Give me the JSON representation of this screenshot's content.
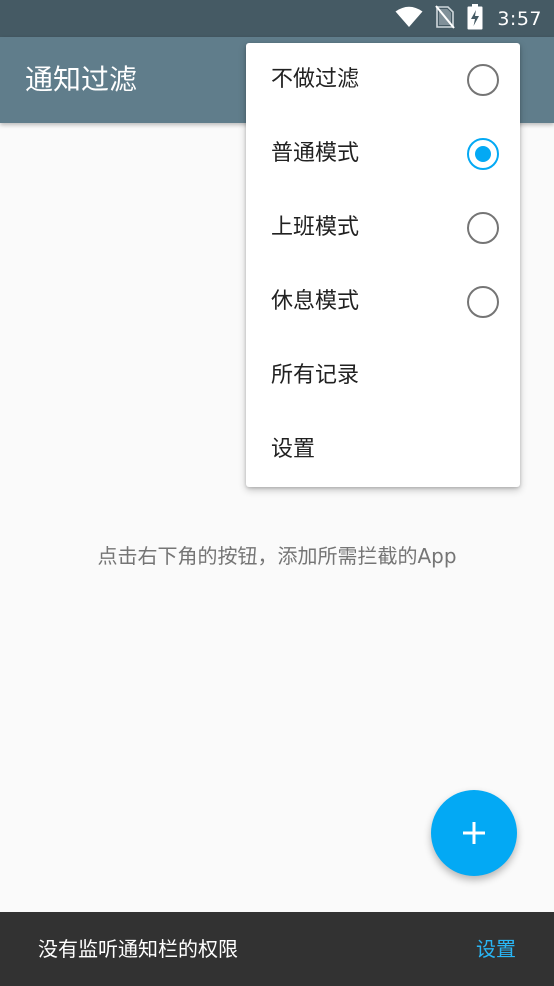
{
  "status_bar": {
    "time": "3:57",
    "icons": [
      "wifi-icon",
      "no-sim-icon",
      "battery-charging-icon"
    ]
  },
  "app_bar": {
    "title": "通知过滤"
  },
  "main": {
    "empty_hint": "点击右下角的按钮，添加所需拦截的App"
  },
  "menu": {
    "items": [
      {
        "label": "不做过滤",
        "type": "radio",
        "checked": false
      },
      {
        "label": "普通模式",
        "type": "radio",
        "checked": true
      },
      {
        "label": "上班模式",
        "type": "radio",
        "checked": false
      },
      {
        "label": "休息模式",
        "type": "radio",
        "checked": false
      },
      {
        "label": "所有记录",
        "type": "action"
      },
      {
        "label": "设置",
        "type": "action"
      }
    ]
  },
  "fab": {
    "icon": "plus-icon"
  },
  "snackbar": {
    "message": "没有监听通知栏的权限",
    "action": "设置"
  },
  "colors": {
    "status_bar": "#455a64",
    "app_bar": "#607d8b",
    "accent": "#03a9f4",
    "snackbar": "#323232",
    "snackbar_action": "#29b6f6"
  }
}
